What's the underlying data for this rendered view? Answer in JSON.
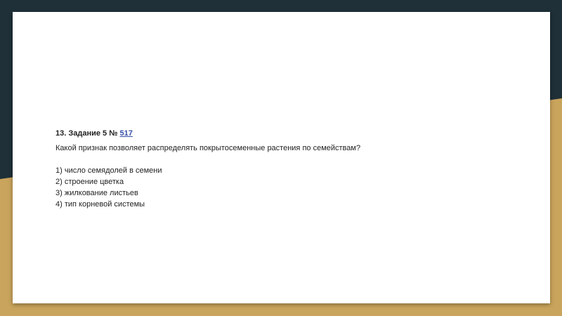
{
  "colors": {
    "background_dark": "#1f3038",
    "background_gold": "#c9a45c",
    "slide": "#ffffff",
    "link": "#3a4fa8"
  },
  "task": {
    "prefix": "13. Задание 5 № ",
    "number_link": "517",
    "question": "Какой признак позволяет распределять покрытосеменные растения по семействам?",
    "options": [
      "1) число семядолей в семени",
      "2) строение цветка",
      "3) жилкование листьев",
      "4) тип корневой системы"
    ]
  }
}
